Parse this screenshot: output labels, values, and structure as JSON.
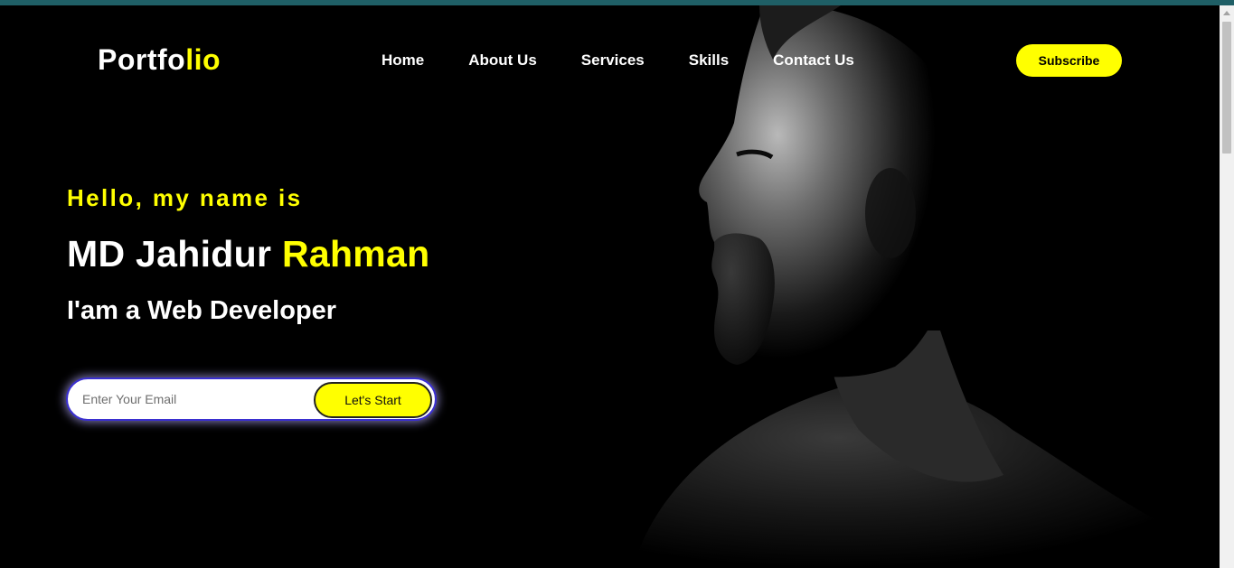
{
  "logo": {
    "prefix": "Portfo",
    "accent": "lio"
  },
  "nav": {
    "items": [
      "Home",
      "About Us",
      "Services",
      "Skills",
      "Contact Us"
    ]
  },
  "header": {
    "subscribe_label": "Subscribe"
  },
  "hero": {
    "greeting": "Hello, my name is",
    "name_first": "MD Jahidur ",
    "name_accent": "Rahman",
    "role": "I'am a Web Developer",
    "email_placeholder": "Enter Your Email",
    "cta_label": "Let's Start"
  },
  "colors": {
    "accent": "#ffff00",
    "background": "#000000",
    "top_strip": "#1f5f66"
  }
}
